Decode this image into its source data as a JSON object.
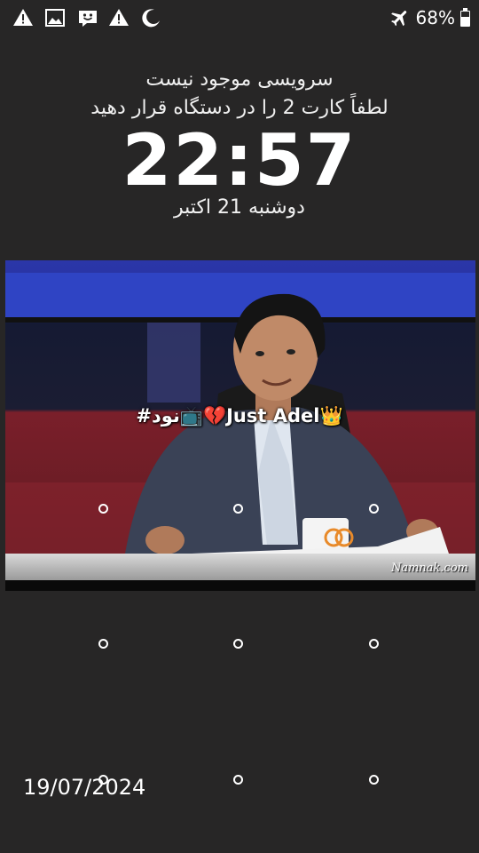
{
  "status_bar": {
    "left_icons": [
      "warning-icon",
      "image-icon",
      "smiley-icon",
      "warning-icon",
      "moon-icon"
    ],
    "right_icons": [
      "airplane-icon",
      "battery-icon"
    ],
    "battery_percent": "68%",
    "battery_level": 0.68
  },
  "lock_screen": {
    "carrier_line1": "سرویسی موجود نیست",
    "carrier_line2": "لطفاً کارت 2 را در دستگاه قرار دهید",
    "clock": "22:57",
    "date": "دوشنبه 21 اکتبر",
    "owner_info": "#نود📺💔Just Adel👑"
  },
  "wallpaper": {
    "watermark": "Namnak.com"
  },
  "pattern_lock": {
    "rows": 3,
    "cols": 3
  },
  "overlay": {
    "timestamp": "19/07/2024"
  }
}
